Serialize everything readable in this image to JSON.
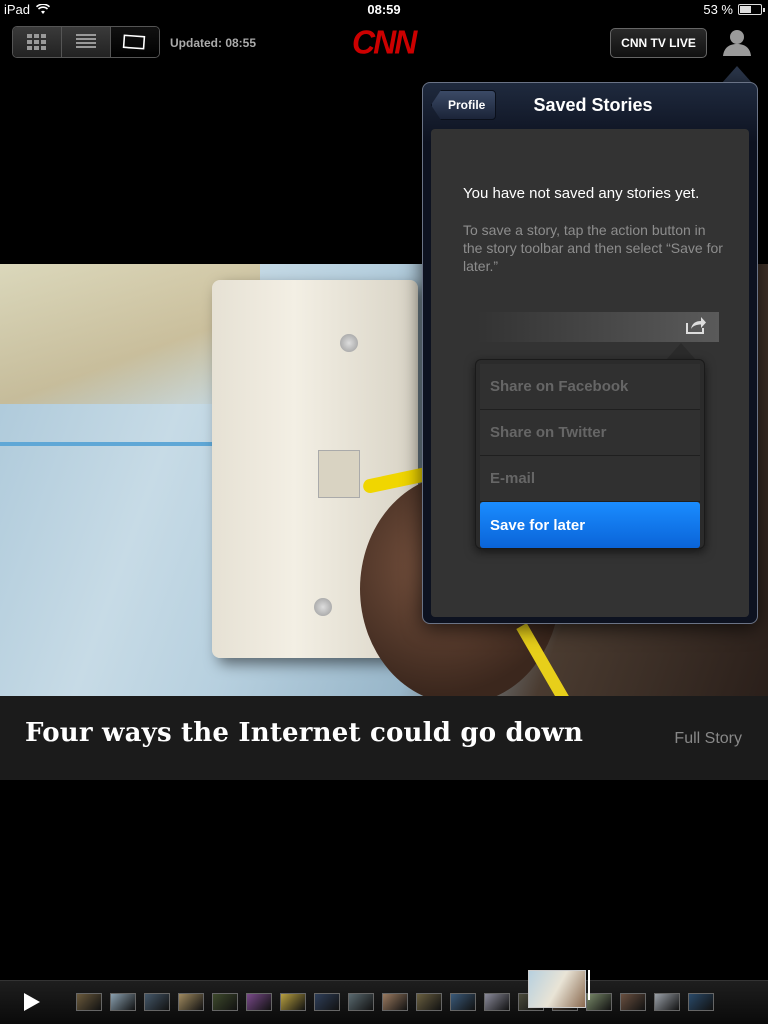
{
  "status_bar": {
    "device": "iPad",
    "time": "08:59",
    "battery": "53 %",
    "battery_level": 0.53
  },
  "toolbar": {
    "view_modes": [
      "grid-view-icon",
      "list-view-icon",
      "single-story-view-icon"
    ],
    "selected_view": "single-story-view-icon",
    "updated": "Updated: 08:55",
    "logo": "CNN",
    "tv_live_label": "CNN TV LIVE",
    "profile_icon": "person-icon"
  },
  "popover": {
    "back_label": "Profile",
    "title": "Saved Stories",
    "empty_title": "You have not saved any stories yet.",
    "empty_help": "To save a story, tap the action button in the story toolbar and then select “Save for later.”",
    "demo_menu": [
      "Share on Facebook",
      "Share on Twitter",
      "E-mail",
      "Save for later"
    ],
    "demo_menu_selected": "Save for later",
    "accent_color": "#0a6fe0"
  },
  "story": {
    "headline": "Four ways the Internet could go down",
    "full_story_label": "Full Story"
  },
  "filmstrip": {
    "play_icon": "play-icon",
    "thumb_colors": [
      "#6b5a3c",
      "#8aa0b0",
      "#45586a",
      "#a08a60",
      "#3e4a2c",
      "#7a4a8a",
      "#b8a040",
      "#2f3f5a",
      "#5a6a70",
      "#9a7a60",
      "#6a6040",
      "#3a5a7a",
      "#8a8a9a",
      "#4a4a3a",
      "#a0c0d0",
      "#5a4a3a",
      "#7a8a6a",
      "#6a5040",
      "#9aa0a8",
      "#2a4a6a"
    ]
  }
}
